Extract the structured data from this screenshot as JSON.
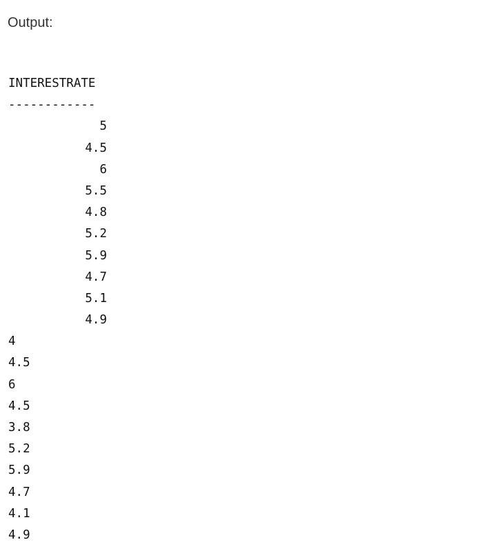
{
  "heading": "Output:",
  "result_table": {
    "column_header": "INTERESTRATE",
    "separator": "------------",
    "values": [
      "5",
      "4.5",
      "6",
      "5.5",
      "4.8",
      "5.2",
      "5.9",
      "4.7",
      "5.1",
      "4.9"
    ]
  },
  "second_output": {
    "values": [
      "4",
      "4.5",
      "6",
      "4.5",
      "3.8",
      "5.2",
      "5.9",
      "4.7",
      "4.1",
      "4.9"
    ]
  }
}
